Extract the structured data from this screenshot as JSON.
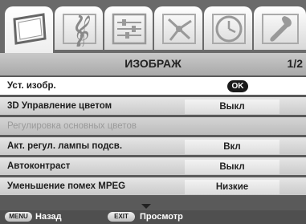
{
  "tabs": [
    {
      "icon": "picture-icon",
      "active": true
    },
    {
      "icon": "sound-icon",
      "active": false
    },
    {
      "icon": "settings-icon",
      "active": false
    },
    {
      "icon": "connection-icon",
      "active": false
    },
    {
      "icon": "timer-icon",
      "active": false
    },
    {
      "icon": "setup-icon",
      "active": false
    }
  ],
  "menu": {
    "title": "ИЗОБРАЖ",
    "page": "1/2"
  },
  "rows": [
    {
      "label": "Уст. изобр.",
      "value": "OK",
      "state": "selected"
    },
    {
      "label": "3D Управление цветом",
      "value": "Выкл",
      "state": "normal"
    },
    {
      "label": "Регулировка основных цветов",
      "value": "",
      "state": "disabled"
    },
    {
      "label": "Акт. регул. лампы подсв.",
      "value": "Вкл",
      "state": "normal"
    },
    {
      "label": "Автоконтраст",
      "value": "Выкл",
      "state": "normal"
    },
    {
      "label": "Уменьшение помех MPEG",
      "value": "Низкие",
      "state": "normal"
    }
  ],
  "footer": {
    "menu_key": "MENU",
    "menu_text": "Назад",
    "exit_key": "EXIT",
    "exit_text": "Просмотр"
  },
  "colors": {
    "background": "#5a5a5a",
    "selected_row": "#ffffff",
    "disabled_text": "#9a9a9a"
  }
}
